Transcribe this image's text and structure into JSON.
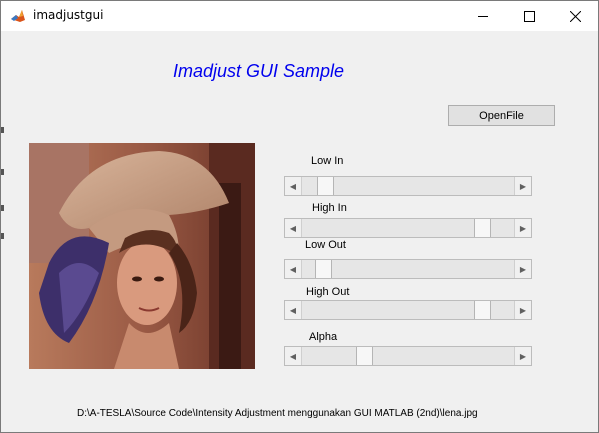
{
  "window": {
    "title": "imadjustgui",
    "minimize_glyph": "—",
    "maximize_glyph": "☐",
    "close_glyph": "✕"
  },
  "gui": {
    "title": "Imadjust GUI Sample",
    "title_color": "#0000ee",
    "openfile_label": "OpenFile"
  },
  "sliders": [
    {
      "label": "Low In",
      "value": 0.08
    },
    {
      "label": "High In",
      "value": 0.88
    },
    {
      "label": "Low Out",
      "value": 0.07
    },
    {
      "label": "High Out",
      "value": 0.88
    },
    {
      "label": "Alpha",
      "value": 0.28
    }
  ],
  "status": {
    "filepath": "D:\\A-TESLA\\Source Code\\Intensity Adjustment menggunakan GUI MATLAB (2nd)\\lena.jpg"
  }
}
